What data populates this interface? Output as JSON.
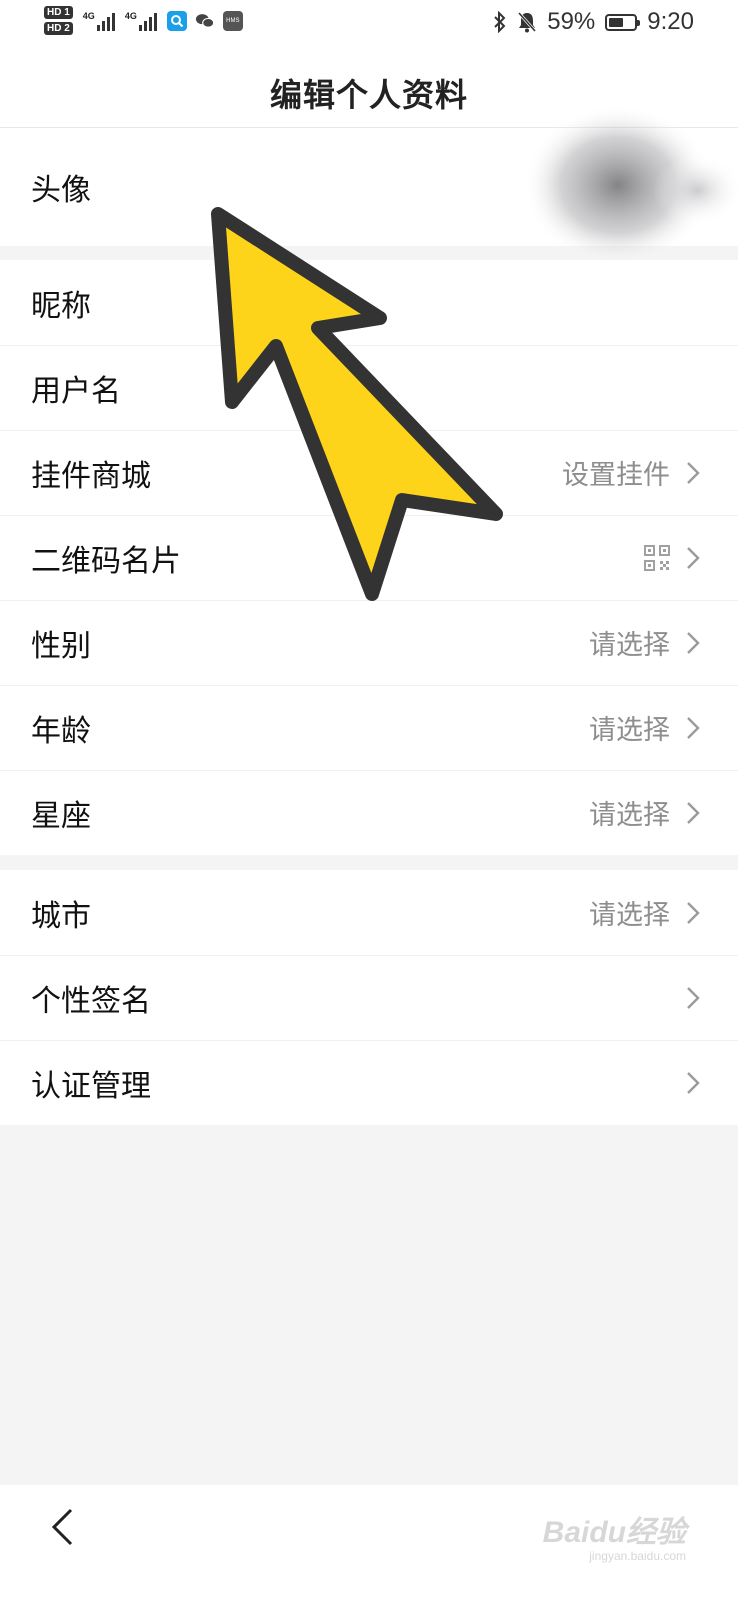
{
  "status_bar": {
    "sim1": "HD 1",
    "sim2": "HD 2",
    "net1": "4G",
    "net2": "4G",
    "hms": "HMS",
    "battery_text": "59%",
    "battery_level": 0.59,
    "time": "9:20",
    "icons": [
      "bluetooth-icon",
      "mute-bell-icon",
      "battery-icon",
      "search-app-icon",
      "wechat-icon"
    ]
  },
  "header": {
    "title": "编辑个人资料"
  },
  "groups": [
    {
      "rows": [
        {
          "label": "头像",
          "value": ""
        }
      ]
    },
    {
      "rows": [
        {
          "label": "昵称",
          "value": ""
        },
        {
          "label": "用户名",
          "value": ""
        },
        {
          "label": "挂件商城",
          "value": "设置挂件"
        },
        {
          "label": "二维码名片",
          "value": ""
        },
        {
          "label": "性别",
          "value": "请选择"
        },
        {
          "label": "年龄",
          "value": "请选择"
        },
        {
          "label": "星座",
          "value": "请选择"
        }
      ]
    },
    {
      "rows": [
        {
          "label": "城市",
          "value": "请选择"
        },
        {
          "label": "个性签名",
          "value": ""
        },
        {
          "label": "认证管理",
          "value": ""
        }
      ]
    }
  ],
  "nav": {
    "back_icon": "chevron-left-icon"
  },
  "watermark": {
    "main": "Baidu经验",
    "sub": "jingyan.baidu.com"
  },
  "colors": {
    "accent_arrow": "#FDD419",
    "arrow_outline": "#333333",
    "value_text": "#8E8E8E",
    "background": "#F4F4F4"
  }
}
